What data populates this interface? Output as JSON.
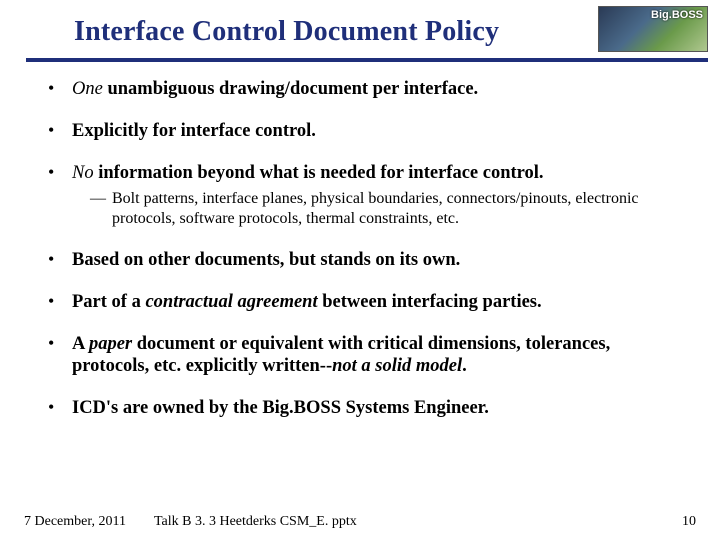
{
  "header": {
    "title": "Interface Control Document Policy",
    "logo_text": "Big.BOSS"
  },
  "bullets": [
    {
      "html": "<i>One</i> <b>unambiguous drawing/document per interface.</b>"
    },
    {
      "html": "<b>Explicitly for interface control.</b>"
    },
    {
      "html": "<i>No</i> <b>information beyond what is needed for interface control.</b>",
      "sub": [
        "Bolt patterns, interface planes, physical boundaries, connectors/pinouts,  electronic protocols,  software protocols, thermal constraints, etc."
      ]
    },
    {
      "html": "<b>Based on other documents, but stands on its own.</b>"
    },
    {
      "html": "<b>Part of a <i>contractual agreement</i> between interfacing parties.</b>"
    },
    {
      "html": "<b>A <i>paper</i> document or equivalent with critical dimensions, tolerances, protocols, etc.  explicitly written--<i>not a solid model</i>.</b>"
    },
    {
      "html": "<b>ICD's are owned by the Big.BOSS Systems Engineer.</b>"
    }
  ],
  "footer": {
    "date": "7 December,  2011",
    "filename": "Talk B 3. 3 Heetderks CSM_E. pptx",
    "page": "10"
  }
}
